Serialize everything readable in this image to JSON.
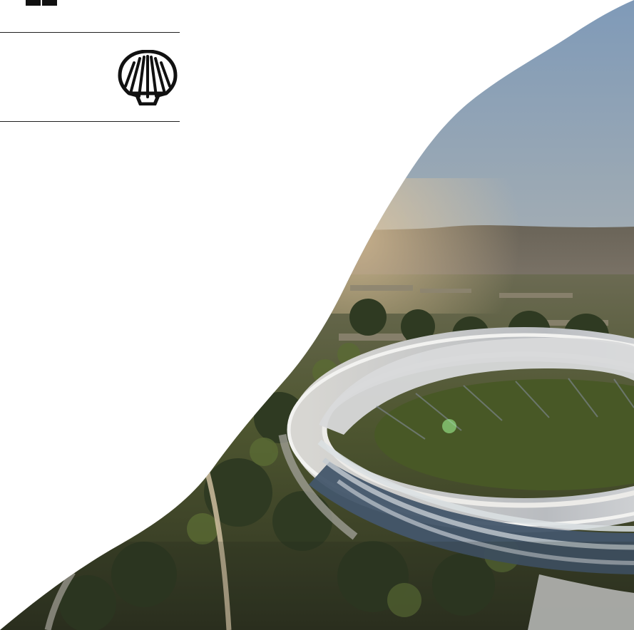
{
  "logos": [
    {
      "icon": "partner-logo-icon",
      "color": "#111111"
    },
    {
      "icon": "shell-logo-icon",
      "color": "#111111"
    }
  ],
  "photo": {
    "subject": "aerial-campus-ring-building-icon",
    "sky_top": "#7f9ab8",
    "sky_bottom": "#c9c3b5",
    "hills": "#5f5c55",
    "trees": "#516030",
    "roof": "#d8d9da",
    "glass": "#43566a"
  }
}
